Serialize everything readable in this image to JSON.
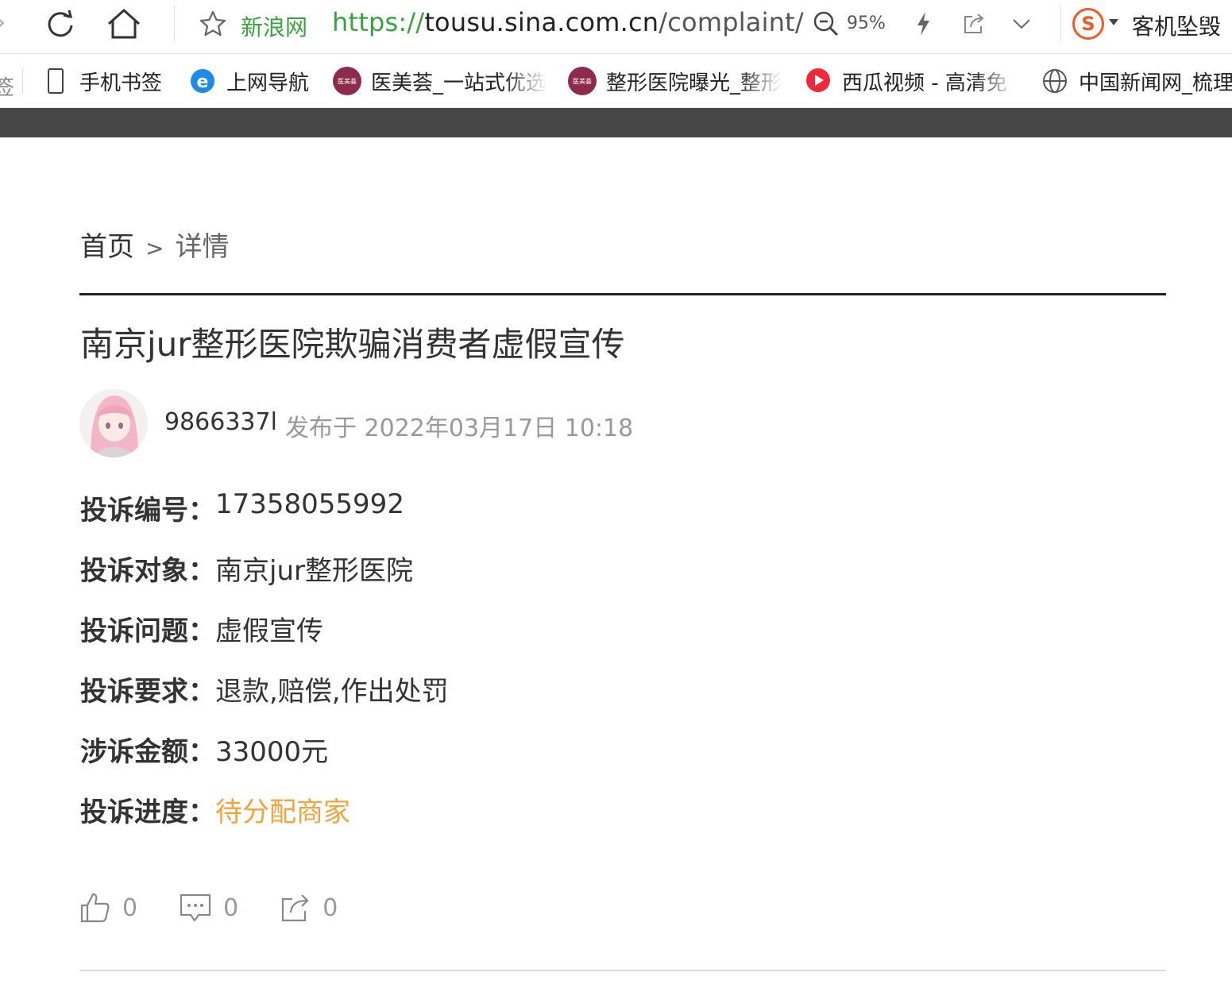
{
  "browser": {
    "site_name": "新浪网",
    "url_scheme": "https://",
    "url_host": "tousu.sina.com.cn",
    "url_path": "/complaint/",
    "zoom": "95%",
    "search_engine_letter": "S",
    "news_ticker": "客机坠毁",
    "icons": [
      "back-arrow-icon",
      "refresh-icon",
      "home-icon",
      "star-icon",
      "zoom-out-icon",
      "bolt-icon",
      "share-icon",
      "chevron-down-icon",
      "sogou-icon"
    ]
  },
  "bookmarks": [
    {
      "label": "手机书签",
      "icon": "phone-icon"
    },
    {
      "label": "上网导航",
      "icon": "ie-icon"
    },
    {
      "label": "医美荟_一站式优选",
      "icon": "yimeihui-icon",
      "icon_text": "医美荟"
    },
    {
      "label": "整形医院曝光_整形",
      "icon": "yimeihui-icon",
      "icon_text": "医美荟"
    },
    {
      "label": "西瓜视频 - 高清免",
      "icon": "xigua-icon"
    },
    {
      "label": "中国新闻网_梳理",
      "icon": "globe-icon"
    }
  ],
  "bookmark_cut_char": "签",
  "page": {
    "breadcrumb": {
      "home": "首页",
      "separator": ">",
      "current": "详情"
    },
    "title": "南京jur整形医院欺骗消费者虚假宣传",
    "author": "9866337l",
    "published": "发布于 2022年03月17日 10:18",
    "details": [
      {
        "key": "投诉编号：",
        "value": "17358055992"
      },
      {
        "key": "投诉对象：",
        "value": "南京jur整形医院"
      },
      {
        "key": "投诉问题：",
        "value": "虚假宣传"
      },
      {
        "key": "投诉要求：",
        "value": "退款,赔偿,作出处罚"
      },
      {
        "key": "涉诉金额：",
        "value": "33000元"
      },
      {
        "key": "投诉进度：",
        "value": "待分配商家"
      }
    ],
    "actions": {
      "likes": "0",
      "comments": "0",
      "shares": "0"
    },
    "colors": {
      "status": "#f3a33a",
      "url_green": "#37a33c",
      "dark_band": "#474747"
    }
  }
}
